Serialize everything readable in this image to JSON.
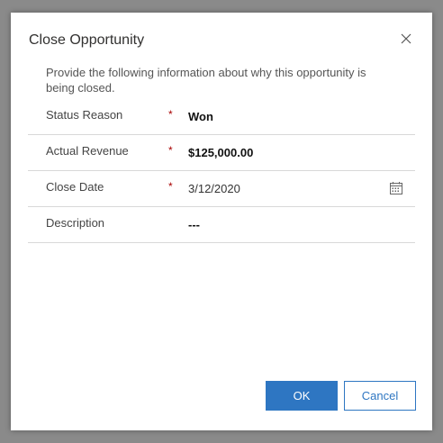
{
  "dialog": {
    "title": "Close Opportunity",
    "description": "Provide the following information about why this opportunity is being closed."
  },
  "fields": [
    {
      "label": "Status Reason",
      "required": "*",
      "value": "Won"
    },
    {
      "label": "Actual Revenue",
      "required": "*",
      "value": "$125,000.00"
    },
    {
      "label": "Close Date",
      "required": "*",
      "value": "3/12/2020"
    },
    {
      "label": "Description",
      "required": "",
      "value": "---"
    }
  ],
  "buttons": {
    "ok_label": "OK",
    "cancel_label": "Cancel"
  },
  "icons": {
    "close": "close-icon",
    "calendar": "calendar-icon"
  },
  "colors": {
    "accent": "#2e76c2",
    "required": "#a80000",
    "overlay": "#8a8a8a"
  }
}
